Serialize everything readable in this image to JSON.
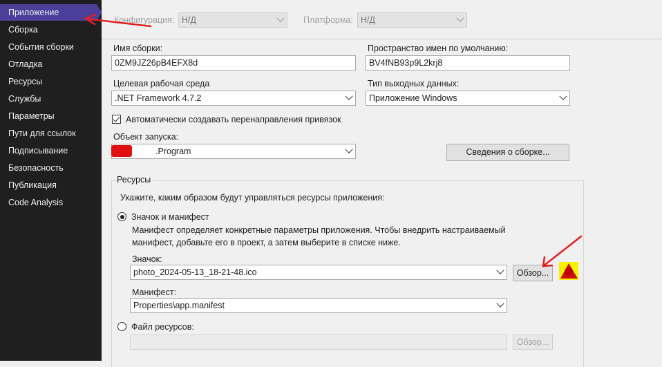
{
  "sidebar": {
    "items": [
      {
        "label": "Приложение",
        "active": true
      },
      {
        "label": "Сборка"
      },
      {
        "label": "События сборки"
      },
      {
        "label": "Отладка"
      },
      {
        "label": "Ресурсы"
      },
      {
        "label": "Службы"
      },
      {
        "label": "Параметры"
      },
      {
        "label": "Пути для ссылок"
      },
      {
        "label": "Подписывание"
      },
      {
        "label": "Безопасность"
      },
      {
        "label": "Публикация"
      },
      {
        "label": "Code Analysis"
      }
    ]
  },
  "toolbar": {
    "config_label": "Конфигурация:",
    "config_value": "Н/Д",
    "platform_label": "Платформа:",
    "platform_value": "Н/Д"
  },
  "form": {
    "assembly_name_label": "Имя сборки:",
    "assembly_name_value": "0ZM9JZ26pB4EFX8d",
    "namespace_label": "Пространство имен по умолчанию:",
    "namespace_value": "BV4fNB93p9L2krj8",
    "framework_label": "Целевая рабочая среда",
    "framework_value": ".NET Framework 4.7.2",
    "output_type_label": "Тип выходных данных:",
    "output_type_value": "Приложение Windows",
    "binding_redirects_label": "Автоматически создавать перенаправления привязок",
    "binding_redirects_checked": true,
    "startup_label": "Объект запуска:",
    "startup_value": "                 .Program",
    "assembly_info_button": "Сведения о сборке..."
  },
  "resources": {
    "group_label": "Ресурсы",
    "instruction": "Укажите, каким образом будут управляться ресурсы приложения:",
    "icon_manifest_option": "Значок и манифест",
    "description_line1": "Манифест определяет конкретные параметры приложения. Чтобы внедрить настраиваемый",
    "description_line2": "манифест, добавьте его в проект, а затем выберите в списке ниже.",
    "icon_label": "Значок:",
    "icon_value": "photo_2024-05-13_18-21-48.ico",
    "browse_button": "Обзор...",
    "manifest_label": "Манифест:",
    "manifest_value": "Properties\\app.manifest",
    "resource_file_option": "Файл ресурсов:",
    "resource_file_value": "",
    "browse_button_disabled": "Обзор..."
  },
  "colors": {
    "sidebar_bg": "#1f1f1f",
    "sidebar_active": "#4b3f9a",
    "annotation_arrow": "#e02020"
  }
}
